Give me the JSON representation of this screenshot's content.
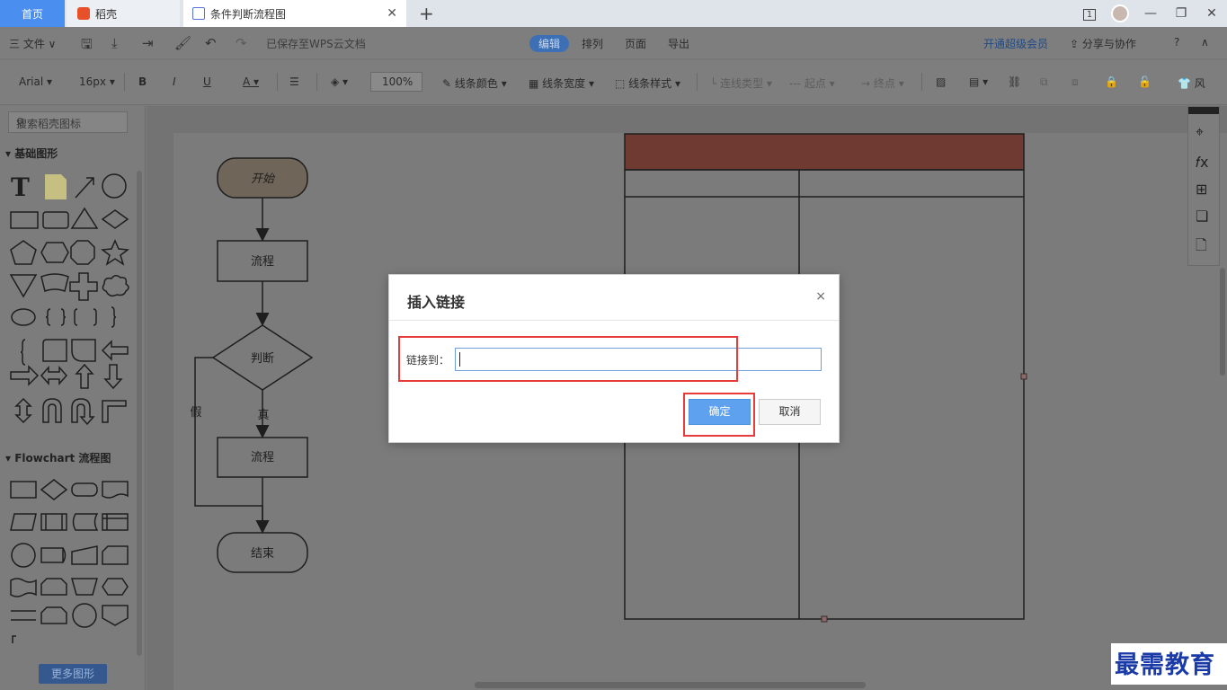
{
  "titlebar": {
    "tabs": [
      {
        "label": "首页"
      },
      {
        "label": "稻壳"
      },
      {
        "label": "条件判断流程图"
      }
    ],
    "page_indicator": "1"
  },
  "menubar": {
    "file": "三 文件 ∨",
    "saved_status": "已保存至WPS云文档",
    "tabs": [
      "编辑",
      "排列",
      "页面",
      "导出"
    ],
    "vip": "开通超级会员",
    "share": "分享与协作"
  },
  "toolbar": {
    "font": "Arial",
    "font_size": "16px",
    "bold": "B",
    "italic": "I",
    "underline": "U",
    "font_color": "A",
    "zoom": "100%",
    "line_color": "线条颜色",
    "line_width": "线条宽度",
    "line_style": "线条样式",
    "connector_type": "连线类型",
    "start_point": "起点",
    "end_point": "终点"
  },
  "sidebar": {
    "search_placeholder": "搜索稻壳图标",
    "section_basic": "基础图形",
    "section_flow": "Flowchart 流程图",
    "more_shapes": "更多图形"
  },
  "flowchart": {
    "start": "开始",
    "process1": "流程",
    "decision": "判断",
    "false_label": "假",
    "true_label": "真",
    "process2": "流程",
    "end": "结束"
  },
  "colors": {
    "accent": "#4a8ff0",
    "header_fill": "#6e3a32",
    "start_fill": "#6f6559",
    "highlight": "#e83b3b",
    "ok_button": "#5ea2ef",
    "watermark": "#1a3aa8"
  },
  "modal": {
    "title": "插入链接",
    "close": "×",
    "link_label": "链接到：",
    "link_value": "",
    "ok": "确定",
    "cancel": "取消"
  },
  "watermark": "最需教育"
}
